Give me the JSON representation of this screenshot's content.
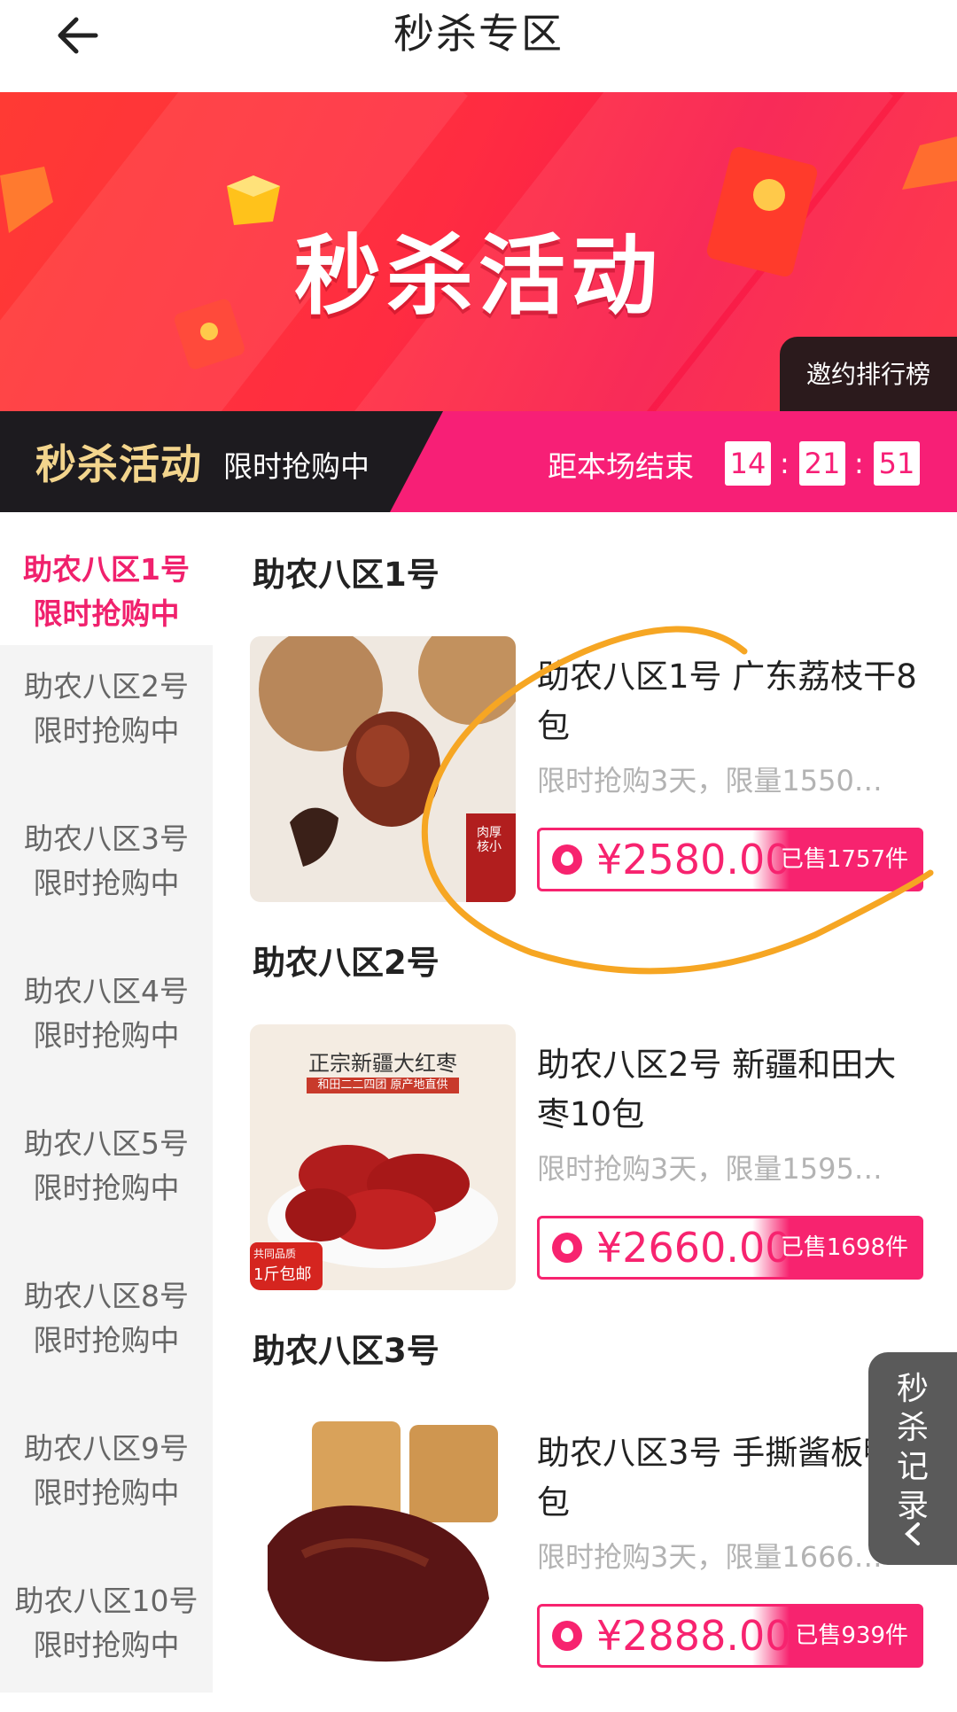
{
  "header": {
    "title": "秒杀专区",
    "back_icon": "arrow-left-icon"
  },
  "banner": {
    "title": "秒杀活动",
    "invite_label": "邀约排行榜"
  },
  "countdown": {
    "logo": "秒杀活动",
    "subtitle": "限时抢购中",
    "end_label": "距本场结束",
    "hours": "14",
    "minutes": "21",
    "seconds": "51",
    "separator": ":"
  },
  "sidebar": {
    "items": [
      {
        "name": "助农八区1号",
        "status": "限时抢购中"
      },
      {
        "name": "助农八区2号",
        "status": "限时抢购中"
      },
      {
        "name": "助农八区3号",
        "status": "限时抢购中"
      },
      {
        "name": "助农八区4号",
        "status": "限时抢购中"
      },
      {
        "name": "助农八区5号",
        "status": "限时抢购中"
      },
      {
        "name": "助农八区8号",
        "status": "限时抢购中"
      },
      {
        "name": "助农八区9号",
        "status": "限时抢购中"
      },
      {
        "name": "助农八区10号",
        "status": "限时抢购中"
      }
    ]
  },
  "sections": [
    {
      "title": "助农八区1号",
      "product": {
        "name": "助农八区1号 广东荔枝干8包",
        "desc": "限时抢购3天，限量1550…",
        "price": "¥2580.00",
        "sold": "已售1757件",
        "image_tag": "肉厚核小"
      }
    },
    {
      "title": "助农八区2号",
      "product": {
        "name": "助农八区2号 新疆和田大枣10包",
        "desc": "限时抢购3天，限量1595…",
        "price": "¥2660.00",
        "sold": "已售1698件",
        "image_title": "正宗新疆大红枣",
        "image_sub": "和田二二四团 原产地直供",
        "image_badge_1": "共同品质",
        "image_badge_2": "1斤包邮"
      }
    },
    {
      "title": "助农八区3号",
      "product": {
        "name": "助农八区3号 手撕酱板鸭6包",
        "desc": "限时抢购3天，限量1666…",
        "price": "¥2888.00",
        "sold": "已售939件"
      }
    }
  ],
  "record_tab": {
    "chars": [
      "秒",
      "杀",
      "记",
      "录"
    ],
    "icon": "chevron-left-icon"
  },
  "colors": {
    "brand": "#f7236f",
    "banner_red": "#ff2c41",
    "annotation": "#f6a623"
  }
}
